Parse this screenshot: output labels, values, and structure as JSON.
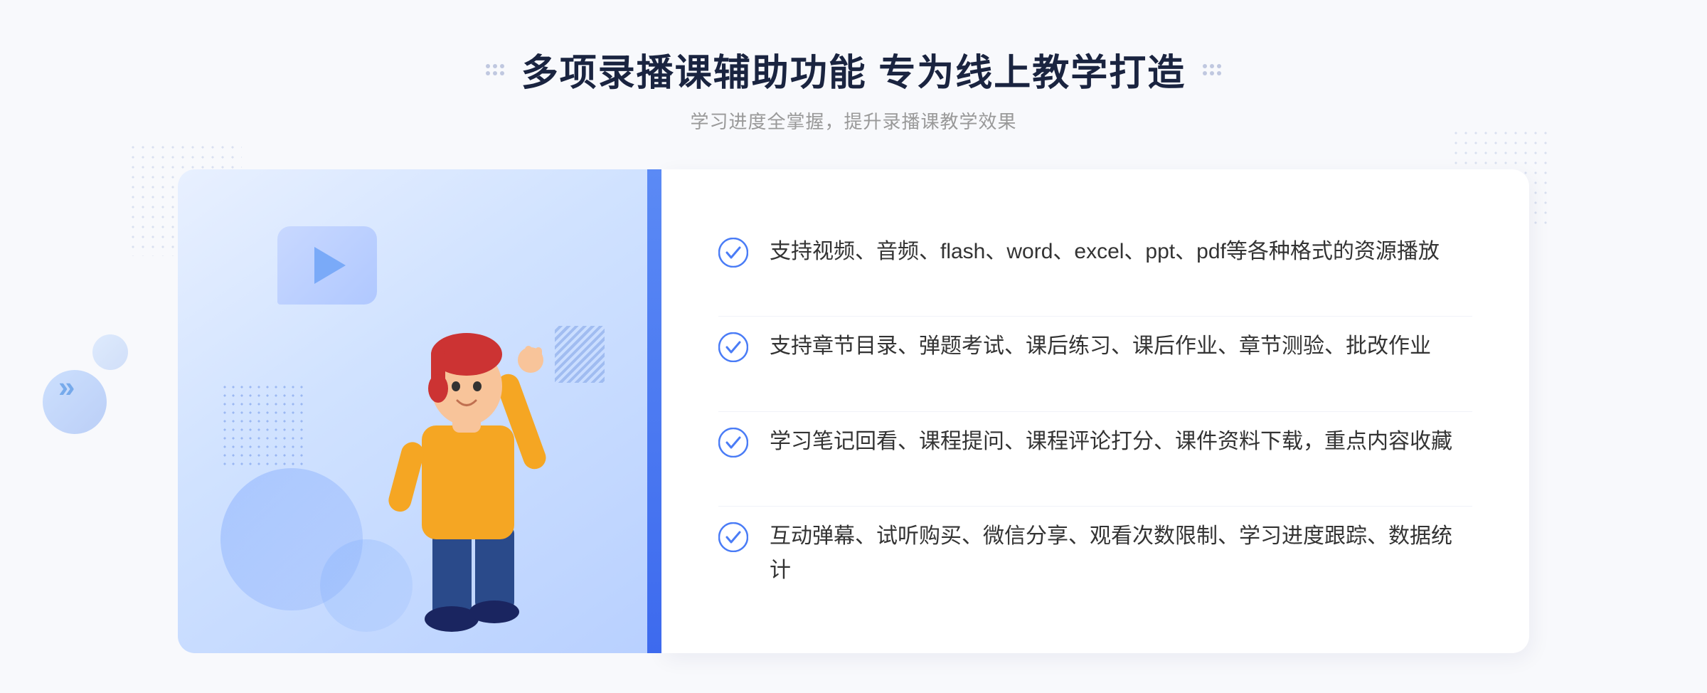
{
  "header": {
    "title": "多项录播课辅助功能 专为线上教学打造",
    "subtitle": "学习进度全掌握，提升录播课教学效果"
  },
  "decorative": {
    "arrow_left": "»"
  },
  "features": [
    {
      "id": 1,
      "text": "支持视频、音频、flash、word、excel、ppt、pdf等各种格式的资源播放"
    },
    {
      "id": 2,
      "text": "支持章节目录、弹题考试、课后练习、课后作业、章节测验、批改作业"
    },
    {
      "id": 3,
      "text": "学习笔记回看、课程提问、课程评论打分、课件资料下载，重点内容收藏"
    },
    {
      "id": 4,
      "text": "互动弹幕、试听购买、微信分享、观看次数限制、学习进度跟踪、数据统计"
    }
  ]
}
